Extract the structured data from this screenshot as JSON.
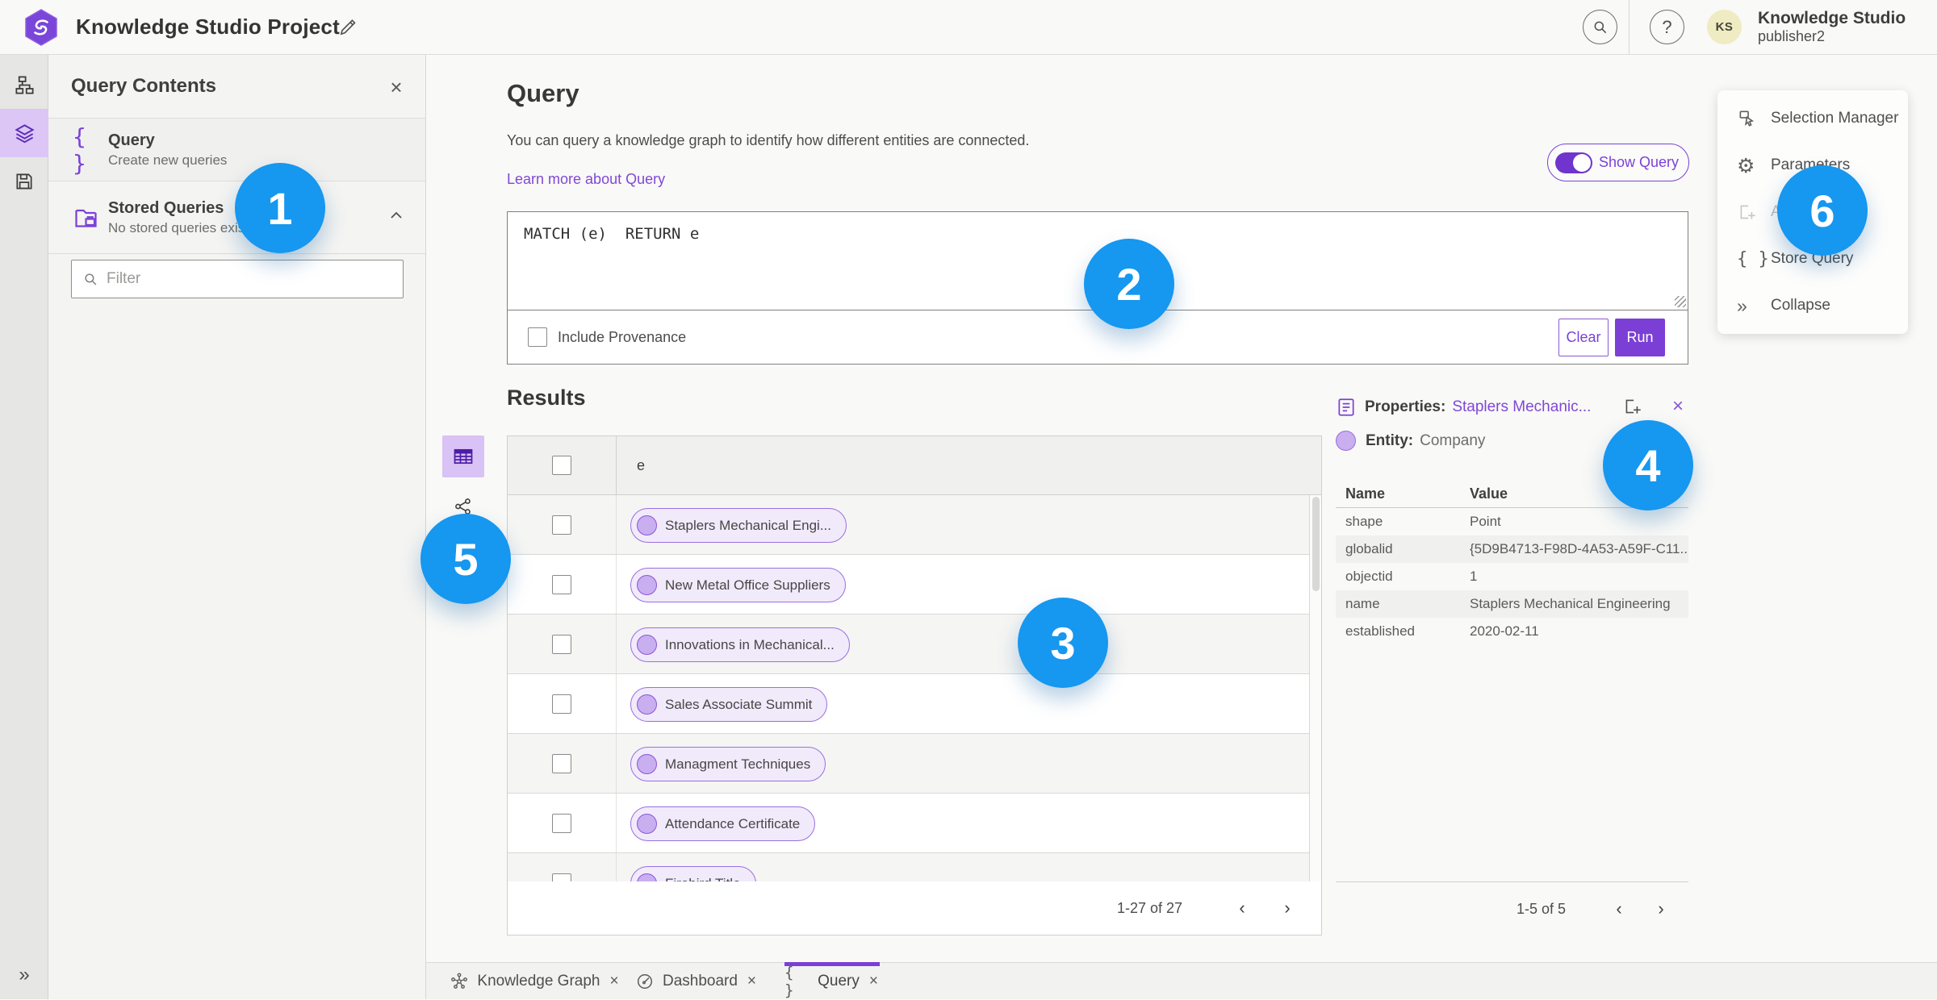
{
  "topbar": {
    "title": "Knowledge Studio Project",
    "app_name": "Knowledge Studio",
    "user": "publisher2",
    "avatar_initials": "KS"
  },
  "icons": {
    "help": "?",
    "close": "×",
    "collapse": "»",
    "chevron_left": "‹",
    "chevron_right": "›",
    "gear": "⚙",
    "braces": "{ }"
  },
  "contents_panel": {
    "title": "Query Contents",
    "query_item": {
      "title": "Query",
      "subtitle": "Create new queries"
    },
    "stored_item": {
      "title": "Stored Queries",
      "subtitle": "No stored queries exist"
    },
    "filter_placeholder": "Filter"
  },
  "query_panel": {
    "heading": "Query",
    "description": "You can query a knowledge graph to identify how different entities are connected.",
    "learn_more": "Learn more about Query",
    "show_query_label": "Show Query",
    "query_text": "MATCH (e)  RETURN e",
    "include_provenance_label": "Include Provenance",
    "clear_label": "Clear",
    "run_label": "Run"
  },
  "results": {
    "heading": "Results",
    "column_header": "e",
    "rows": [
      {
        "label": "Staplers Mechanical Engi..."
      },
      {
        "label": "New Metal Office Suppliers"
      },
      {
        "label": "Innovations in Mechanical..."
      },
      {
        "label": "Sales Associate Summit"
      },
      {
        "label": "Managment Techniques"
      },
      {
        "label": "Attendance Certificate"
      },
      {
        "label": "Firebird Title"
      }
    ],
    "pagination": "1-27 of 27"
  },
  "properties": {
    "heading": "Properties:",
    "entity_link": "Staplers Mechanic...",
    "entity_label": "Entity:",
    "entity_type": "Company",
    "col_name": "Name",
    "col_value": "Value",
    "rows": [
      [
        "shape",
        "Point"
      ],
      [
        "globalid",
        "{5D9B4713-F98D-4A53-A59F-C11..."
      ],
      [
        "objectid",
        "1"
      ],
      [
        "name",
        "Staplers Mechanical Engineering"
      ],
      [
        "established",
        "2020-02-11"
      ]
    ],
    "pagination": "1-5 of 5"
  },
  "menu": {
    "items": [
      {
        "label": "Selection Manager"
      },
      {
        "label": "Parameters"
      },
      {
        "label": "Add",
        "disabled": true
      },
      {
        "label": "Store Query"
      },
      {
        "label": "Collapse"
      }
    ]
  },
  "tabs": {
    "items": [
      {
        "label": "Knowledge Graph"
      },
      {
        "label": "Dashboard"
      },
      {
        "label": "Query",
        "active": true
      }
    ]
  },
  "annotations": [
    "1",
    "2",
    "3",
    "4",
    "5",
    "6"
  ],
  "colors": {
    "accent_purple": "#7b42d8",
    "badge_blue": "#1697f0",
    "chip_fill": "#f1eafb",
    "avatar_yellow": "#efecc3"
  }
}
